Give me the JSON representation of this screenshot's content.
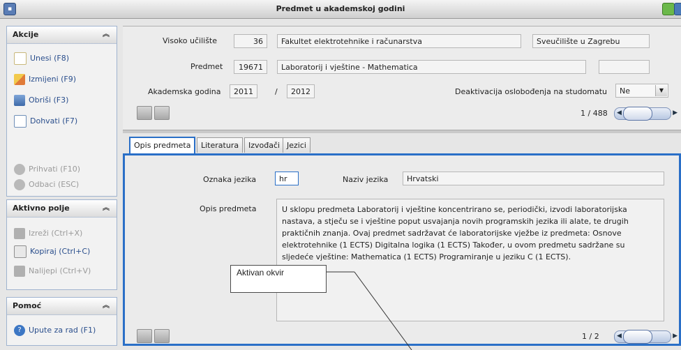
{
  "window": {
    "title": "Predmet u akademskoj godini"
  },
  "sidebar": {
    "akcije": {
      "header": "Akcije",
      "items": [
        {
          "label": "Unesi (F8)",
          "icon": "new-document-icon",
          "enabled": true
        },
        {
          "label": "Izmijeni (F9)",
          "icon": "edit-pencil-icon",
          "enabled": true
        },
        {
          "label": "Obriši (F3)",
          "icon": "delete-icon",
          "enabled": true
        },
        {
          "label": "Dohvati (F7)",
          "icon": "search-icon",
          "enabled": true
        },
        {
          "label": "Prihvati (F10)",
          "icon": "accept-arrow-icon",
          "enabled": false
        },
        {
          "label": "Odbaci (ESC)",
          "icon": "cancel-icon",
          "enabled": false
        }
      ]
    },
    "aktivno_polje": {
      "header": "Aktivno polje",
      "items": [
        {
          "label": "Izreži (Ctrl+X)",
          "icon": "scissors-icon",
          "enabled": false
        },
        {
          "label": "Kopiraj (Ctrl+C)",
          "icon": "copy-icon",
          "enabled": true
        },
        {
          "label": "Nalijepi (Ctrl+V)",
          "icon": "paste-icon",
          "enabled": false
        }
      ]
    },
    "pomoc": {
      "header": "Pomoć",
      "items": [
        {
          "label": "Upute za rad (F1)",
          "icon": "help-icon",
          "enabled": true
        }
      ]
    }
  },
  "form": {
    "visoko_uciliste": {
      "label": "Visoko učilište",
      "code": "36",
      "name": "Fakultet elektrotehnike i računarstva",
      "university": "Sveučilište u Zagrebu"
    },
    "predmet": {
      "label": "Predmet",
      "code": "19671",
      "name": "Laboratorij i vještine - Mathematica",
      "extra": ""
    },
    "akademska_godina": {
      "label": "Akademska godina",
      "from": "2011",
      "separator": "/",
      "to": "2012"
    },
    "deaktivacija": {
      "label": "Deaktivacija oslobođenja na studomatu",
      "value": "Ne"
    },
    "pager": {
      "text": "1 / 488",
      "position": 0.08
    }
  },
  "tabs": [
    {
      "label": "Opis predmeta",
      "active": true
    },
    {
      "label": "Literatura",
      "active": false
    },
    {
      "label": "Izvođači",
      "active": false
    },
    {
      "label": "Jezici",
      "active": false
    }
  ],
  "detail": {
    "oznaka_jezika": {
      "label": "Oznaka jezika",
      "value": "hr"
    },
    "naziv_jezika": {
      "label": "Naziv jezika",
      "value": "Hrvatski"
    },
    "opis": {
      "label": "Opis predmeta",
      "text": "U sklopu predmeta Laboratorij i vještine koncentrirano se, periodički, izvodi laboratorijska nastava, a stječu se i vještine poput usvajanja novih programskih jezika ili alate, te drugih praktičnih znanja. Ovaj predmet sadržavat će laboratorijske vježbe iz predmeta: Osnove elektrotehnike (1 ECTS) Digitalna logika (1 ECTS) Također, u ovom predmetu sadržane su sljedeće vještine: Mathematica (1 ECTS) Programiranje u jeziku C (1 ECTS)."
    },
    "pager": {
      "text": "1 / 2",
      "position": 0.08
    }
  },
  "annotation": {
    "callout": "Aktivan okvir"
  },
  "colors": {
    "accent": "#2a6fc7",
    "link": "#2a4e8c"
  }
}
